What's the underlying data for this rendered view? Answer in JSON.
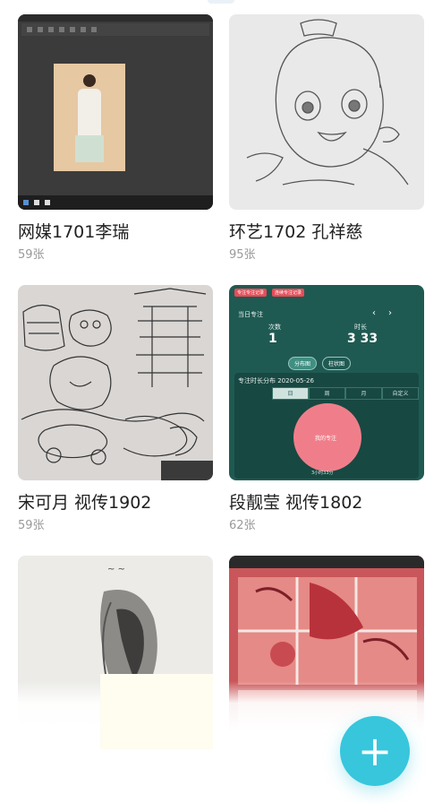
{
  "albums": [
    {
      "title": "网媒1701李瑞",
      "count": "59张"
    },
    {
      "title": "环艺1702 孔祥慈",
      "count": "95张"
    },
    {
      "title": "宋可月 视传1902",
      "count": "59张"
    },
    {
      "title": "段靓莹 视传1802",
      "count": "62张"
    },
    {
      "title": "",
      "count": ""
    },
    {
      "title": "",
      "count": ""
    }
  ],
  "focus_app": {
    "badges": [
      "专注专注记录",
      "连续专注记录"
    ],
    "today_label": "当日专注",
    "times_label": "次数",
    "times_value": "1",
    "duration_label": "时长",
    "duration_value": "3 33",
    "pills": [
      "分布图",
      "柱状图"
    ],
    "dist_label": "专注时长分布  2020-05-26",
    "tabs": [
      "日",
      "周",
      "月",
      "自定义"
    ],
    "circle_label": "我的专注",
    "total_label": "3小时33分"
  },
  "fab": {
    "symbol": "+"
  },
  "colors": {
    "fab": "#37c6dc",
    "title": "#222222",
    "count": "#999999"
  },
  "icons": {
    "fab": "plus-icon"
  }
}
